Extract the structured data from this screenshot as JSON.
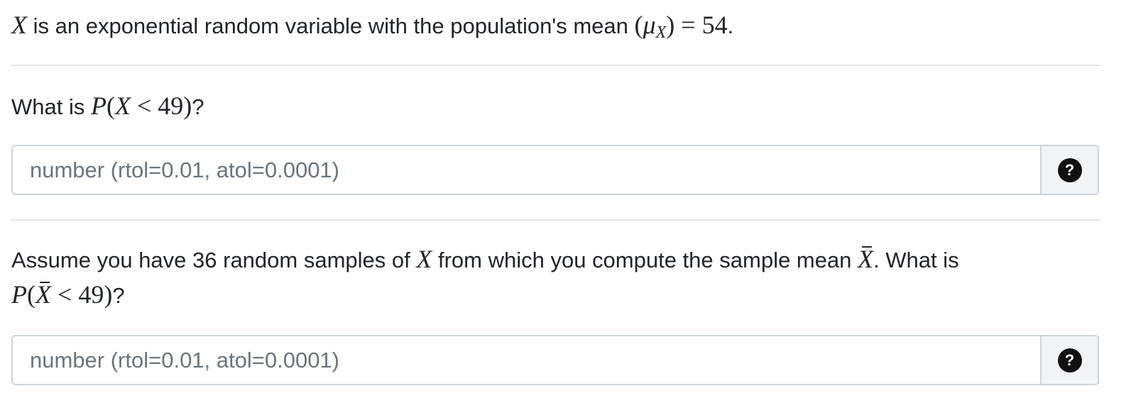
{
  "intro": {
    "var": "X",
    "text_a": " is an exponential random variable with the population's mean ",
    "mean_open": "(",
    "mu": "μ",
    "mu_sub": "X",
    "mean_close": ")",
    "equals": " = ",
    "mean_value": "54",
    "period": "."
  },
  "question1": {
    "prefix": "What is ",
    "expr_p": "P",
    "expr_open": "(",
    "expr_var": "X",
    "expr_lt": " < ",
    "expr_num": "49",
    "expr_close": ")",
    "suffix": "?"
  },
  "answer1": {
    "placeholder": "number (rtol=0.01, atol=0.0001)",
    "value": "",
    "help_icon": "?"
  },
  "question2": {
    "text_a": "Assume you have 36 random samples of ",
    "var": "X",
    "text_b": " from which you compute the sample mean ",
    "bar_var": "X",
    "text_c": ". What is",
    "expr_p": "P",
    "expr_open": "(",
    "expr_var": "X",
    "expr_lt": " < ",
    "expr_num": "49",
    "expr_close": ")",
    "suffix": "?"
  },
  "answer2": {
    "placeholder": "number (rtol=0.01, atol=0.0001)",
    "value": "",
    "help_icon": "?"
  }
}
